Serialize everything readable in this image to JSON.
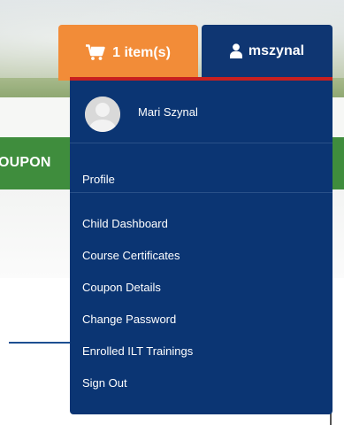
{
  "background": {
    "green_bar_text": "OUPON"
  },
  "cart": {
    "icon": "shopping-cart-icon",
    "label": "1 item(s)",
    "color": "#f28c38"
  },
  "user": {
    "icon": "user-icon",
    "username": "mszynal",
    "full_name": "Mari Szynal",
    "color": "#0f3672",
    "accent": "#c8201f"
  },
  "menu": {
    "profile": "Profile",
    "items": [
      "Child Dashboard",
      "Course Certificates",
      "Coupon Details",
      "Change Password",
      "Enrolled ILT Trainings",
      "Sign Out"
    ]
  }
}
